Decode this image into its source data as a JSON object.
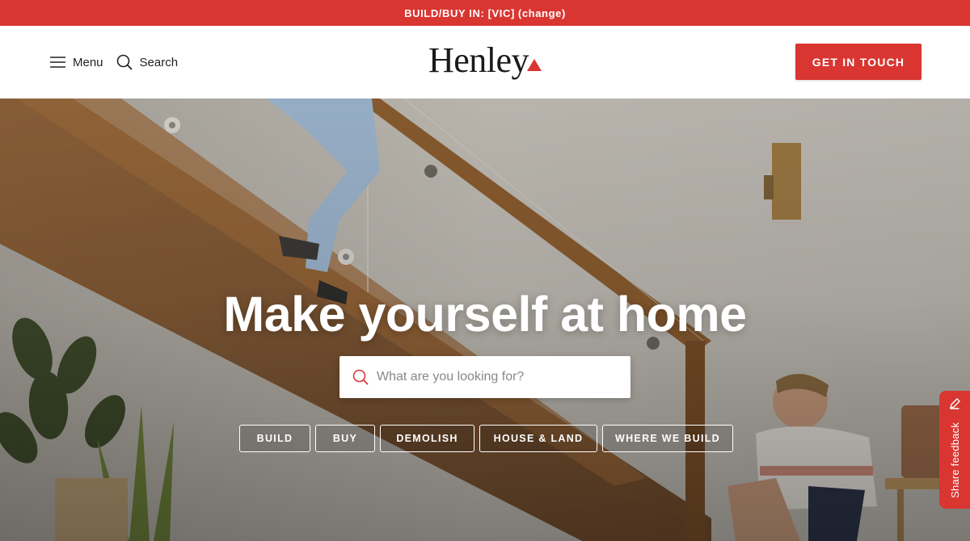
{
  "banner": {
    "label": "BUILD/BUY IN: [VIC]",
    "change": "(change)"
  },
  "header": {
    "menu_label": "Menu",
    "search_label": "Search",
    "logo_text": "Henley",
    "cta_label": "GET IN TOUCH"
  },
  "hero": {
    "headline": "Make yourself at home",
    "search_placeholder": "What are you looking for?",
    "pills": [
      "BUILD",
      "BUY",
      "DEMOLISH",
      "HOUSE & LAND",
      "WHERE WE BUILD"
    ]
  },
  "feedback": {
    "label": "Share feedback"
  },
  "colors": {
    "accent": "#d93632",
    "text": "#1a1a1a"
  }
}
